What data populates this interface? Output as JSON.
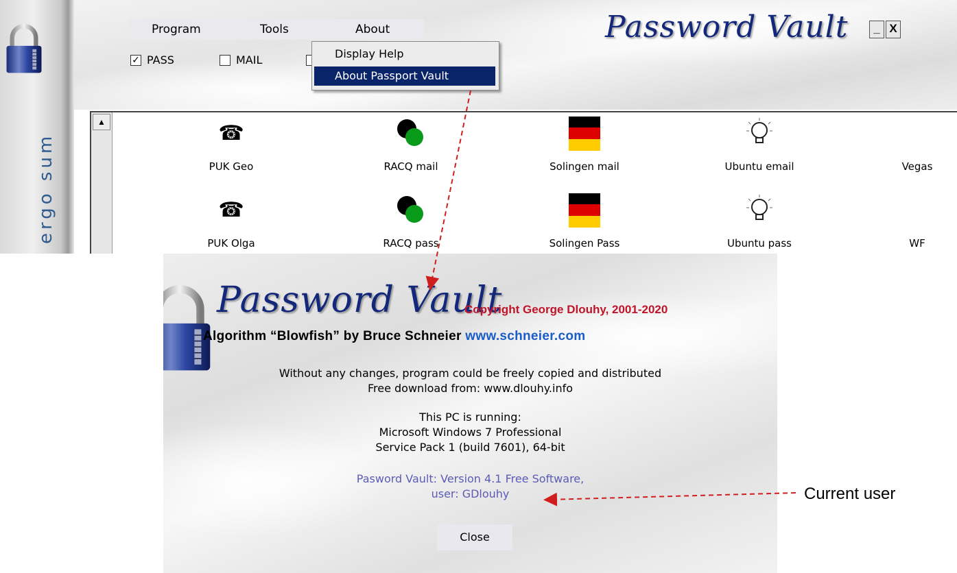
{
  "side_strip": {
    "text": "ergo sum"
  },
  "menubar": {
    "items": [
      "Program",
      "Tools",
      "About"
    ]
  },
  "checkboxes": [
    {
      "label": "PASS",
      "checked": true
    },
    {
      "label": "MAIL",
      "checked": false
    }
  ],
  "dropdown": {
    "items": [
      "Display Help",
      "About Passport Vault"
    ],
    "selected": "About Passport Vault"
  },
  "app_title": "Password Vault",
  "window_controls": {
    "minimize": "_",
    "close": "X"
  },
  "list": {
    "row1": [
      "PUK Geo",
      "RACQ mail",
      "Solingen mail",
      "Ubuntu email",
      "Vegas"
    ],
    "row2": [
      "PUK Olga",
      "RACQ pass",
      "Solingen Pass",
      "Ubuntu pass",
      "WF"
    ],
    "icons": [
      "phone-icon",
      "two-circles-icon",
      "german-flag-icon",
      "lightbulb-icon"
    ]
  },
  "about": {
    "title": "Password Vault",
    "copyright": "Copyright George Dlouhy, 2001-2020",
    "algorithm": "Algorithm “Blowfish” by Bruce Schneier",
    "algorithm_link": "www.schneier.com",
    "license_line1": "Without any changes, program could be freely copied and distributed",
    "license_line2": "Free download from: www.dlouhy.info",
    "pc_line1": "This PC is running:",
    "pc_line2": "Microsoft Windows 7 Professional",
    "pc_line3": "Service Pack 1 (build 7601), 64-bit",
    "version_line1": "Pasword Vault: Version 4.1 Free Software,",
    "version_line2": "user: GDlouhy",
    "close_label": "Close"
  },
  "annotation": {
    "label": "Current user"
  },
  "colors": {
    "accent_blue": "#13287a",
    "selection": "#0a246a",
    "copyright_red": "#c0142a",
    "link_blue": "#1a5cc8",
    "annotation_red": "#d01e1e"
  }
}
